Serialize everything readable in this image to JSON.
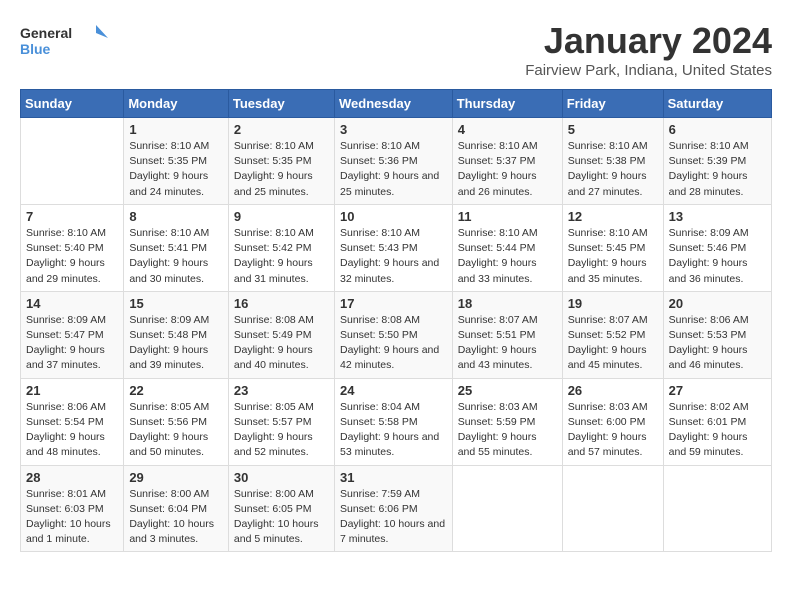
{
  "logo": {
    "line1": "General",
    "line2": "Blue"
  },
  "title": "January 2024",
  "subtitle": "Fairview Park, Indiana, United States",
  "days_of_week": [
    "Sunday",
    "Monday",
    "Tuesday",
    "Wednesday",
    "Thursday",
    "Friday",
    "Saturday"
  ],
  "weeks": [
    [
      {
        "day": "",
        "sunrise": "",
        "sunset": "",
        "daylight": ""
      },
      {
        "day": "1",
        "sunrise": "Sunrise: 8:10 AM",
        "sunset": "Sunset: 5:35 PM",
        "daylight": "Daylight: 9 hours and 24 minutes."
      },
      {
        "day": "2",
        "sunrise": "Sunrise: 8:10 AM",
        "sunset": "Sunset: 5:35 PM",
        "daylight": "Daylight: 9 hours and 25 minutes."
      },
      {
        "day": "3",
        "sunrise": "Sunrise: 8:10 AM",
        "sunset": "Sunset: 5:36 PM",
        "daylight": "Daylight: 9 hours and 25 minutes."
      },
      {
        "day": "4",
        "sunrise": "Sunrise: 8:10 AM",
        "sunset": "Sunset: 5:37 PM",
        "daylight": "Daylight: 9 hours and 26 minutes."
      },
      {
        "day": "5",
        "sunrise": "Sunrise: 8:10 AM",
        "sunset": "Sunset: 5:38 PM",
        "daylight": "Daylight: 9 hours and 27 minutes."
      },
      {
        "day": "6",
        "sunrise": "Sunrise: 8:10 AM",
        "sunset": "Sunset: 5:39 PM",
        "daylight": "Daylight: 9 hours and 28 minutes."
      }
    ],
    [
      {
        "day": "7",
        "sunrise": "Sunrise: 8:10 AM",
        "sunset": "Sunset: 5:40 PM",
        "daylight": "Daylight: 9 hours and 29 minutes."
      },
      {
        "day": "8",
        "sunrise": "Sunrise: 8:10 AM",
        "sunset": "Sunset: 5:41 PM",
        "daylight": "Daylight: 9 hours and 30 minutes."
      },
      {
        "day": "9",
        "sunrise": "Sunrise: 8:10 AM",
        "sunset": "Sunset: 5:42 PM",
        "daylight": "Daylight: 9 hours and 31 minutes."
      },
      {
        "day": "10",
        "sunrise": "Sunrise: 8:10 AM",
        "sunset": "Sunset: 5:43 PM",
        "daylight": "Daylight: 9 hours and 32 minutes."
      },
      {
        "day": "11",
        "sunrise": "Sunrise: 8:10 AM",
        "sunset": "Sunset: 5:44 PM",
        "daylight": "Daylight: 9 hours and 33 minutes."
      },
      {
        "day": "12",
        "sunrise": "Sunrise: 8:10 AM",
        "sunset": "Sunset: 5:45 PM",
        "daylight": "Daylight: 9 hours and 35 minutes."
      },
      {
        "day": "13",
        "sunrise": "Sunrise: 8:09 AM",
        "sunset": "Sunset: 5:46 PM",
        "daylight": "Daylight: 9 hours and 36 minutes."
      }
    ],
    [
      {
        "day": "14",
        "sunrise": "Sunrise: 8:09 AM",
        "sunset": "Sunset: 5:47 PM",
        "daylight": "Daylight: 9 hours and 37 minutes."
      },
      {
        "day": "15",
        "sunrise": "Sunrise: 8:09 AM",
        "sunset": "Sunset: 5:48 PM",
        "daylight": "Daylight: 9 hours and 39 minutes."
      },
      {
        "day": "16",
        "sunrise": "Sunrise: 8:08 AM",
        "sunset": "Sunset: 5:49 PM",
        "daylight": "Daylight: 9 hours and 40 minutes."
      },
      {
        "day": "17",
        "sunrise": "Sunrise: 8:08 AM",
        "sunset": "Sunset: 5:50 PM",
        "daylight": "Daylight: 9 hours and 42 minutes."
      },
      {
        "day": "18",
        "sunrise": "Sunrise: 8:07 AM",
        "sunset": "Sunset: 5:51 PM",
        "daylight": "Daylight: 9 hours and 43 minutes."
      },
      {
        "day": "19",
        "sunrise": "Sunrise: 8:07 AM",
        "sunset": "Sunset: 5:52 PM",
        "daylight": "Daylight: 9 hours and 45 minutes."
      },
      {
        "day": "20",
        "sunrise": "Sunrise: 8:06 AM",
        "sunset": "Sunset: 5:53 PM",
        "daylight": "Daylight: 9 hours and 46 minutes."
      }
    ],
    [
      {
        "day": "21",
        "sunrise": "Sunrise: 8:06 AM",
        "sunset": "Sunset: 5:54 PM",
        "daylight": "Daylight: 9 hours and 48 minutes."
      },
      {
        "day": "22",
        "sunrise": "Sunrise: 8:05 AM",
        "sunset": "Sunset: 5:56 PM",
        "daylight": "Daylight: 9 hours and 50 minutes."
      },
      {
        "day": "23",
        "sunrise": "Sunrise: 8:05 AM",
        "sunset": "Sunset: 5:57 PM",
        "daylight": "Daylight: 9 hours and 52 minutes."
      },
      {
        "day": "24",
        "sunrise": "Sunrise: 8:04 AM",
        "sunset": "Sunset: 5:58 PM",
        "daylight": "Daylight: 9 hours and 53 minutes."
      },
      {
        "day": "25",
        "sunrise": "Sunrise: 8:03 AM",
        "sunset": "Sunset: 5:59 PM",
        "daylight": "Daylight: 9 hours and 55 minutes."
      },
      {
        "day": "26",
        "sunrise": "Sunrise: 8:03 AM",
        "sunset": "Sunset: 6:00 PM",
        "daylight": "Daylight: 9 hours and 57 minutes."
      },
      {
        "day": "27",
        "sunrise": "Sunrise: 8:02 AM",
        "sunset": "Sunset: 6:01 PM",
        "daylight": "Daylight: 9 hours and 59 minutes."
      }
    ],
    [
      {
        "day": "28",
        "sunrise": "Sunrise: 8:01 AM",
        "sunset": "Sunset: 6:03 PM",
        "daylight": "Daylight: 10 hours and 1 minute."
      },
      {
        "day": "29",
        "sunrise": "Sunrise: 8:00 AM",
        "sunset": "Sunset: 6:04 PM",
        "daylight": "Daylight: 10 hours and 3 minutes."
      },
      {
        "day": "30",
        "sunrise": "Sunrise: 8:00 AM",
        "sunset": "Sunset: 6:05 PM",
        "daylight": "Daylight: 10 hours and 5 minutes."
      },
      {
        "day": "31",
        "sunrise": "Sunrise: 7:59 AM",
        "sunset": "Sunset: 6:06 PM",
        "daylight": "Daylight: 10 hours and 7 minutes."
      },
      {
        "day": "",
        "sunrise": "",
        "sunset": "",
        "daylight": ""
      },
      {
        "day": "",
        "sunrise": "",
        "sunset": "",
        "daylight": ""
      },
      {
        "day": "",
        "sunrise": "",
        "sunset": "",
        "daylight": ""
      }
    ]
  ]
}
